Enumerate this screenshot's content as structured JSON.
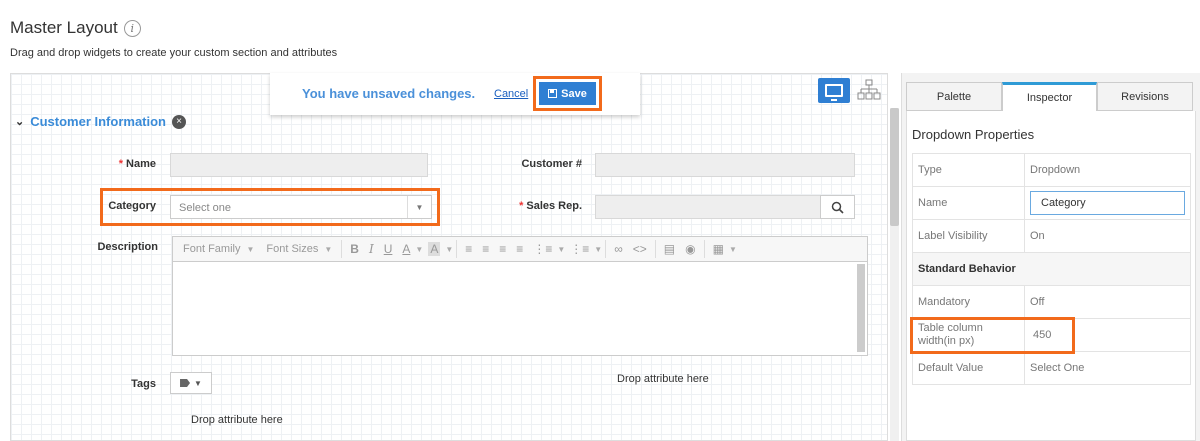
{
  "page": {
    "title": "Master Layout",
    "subtitle": "Drag and drop widgets to create your custom section and attributes"
  },
  "unsaved": {
    "message": "You have unsaved changes.",
    "cancel_label": "Cancel",
    "save_label": "Save"
  },
  "section": {
    "title": "Customer Information"
  },
  "fields": {
    "name_label": "Name",
    "customer_no_label": "Customer #",
    "category_label": "Category",
    "category_placeholder": "Select one",
    "sales_rep_label": "Sales Rep.",
    "description_label": "Description",
    "tags_label": "Tags"
  },
  "editor": {
    "font_family": "Font Family",
    "font_sizes": "Font Sizes"
  },
  "drop_hints": {
    "right": "Drop attribute here",
    "bottom": "Drop attribute here"
  },
  "panel": {
    "tabs": [
      {
        "label": "Palette"
      },
      {
        "label": "Inspector"
      },
      {
        "label": "Revisions"
      }
    ],
    "active_tab": "Inspector",
    "properties_title": "Dropdown Properties",
    "rows": {
      "type_key": "Type",
      "type_value": "Dropdown",
      "name_key": "Name",
      "name_value": "Category",
      "label_visibility_key": "Label Visibility",
      "label_visibility_value": "On",
      "standard_behavior": "Standard Behavior",
      "mandatory_key": "Mandatory",
      "mandatory_value": "Off",
      "table_width_key": "Table column width(in px)",
      "table_width_value": "450",
      "default_value_key": "Default Value",
      "default_value_value": "Select One"
    }
  },
  "colors": {
    "accent_blue": "#2f7fd3",
    "highlight_orange": "#f26a1b",
    "required_red": "#ee3333"
  }
}
